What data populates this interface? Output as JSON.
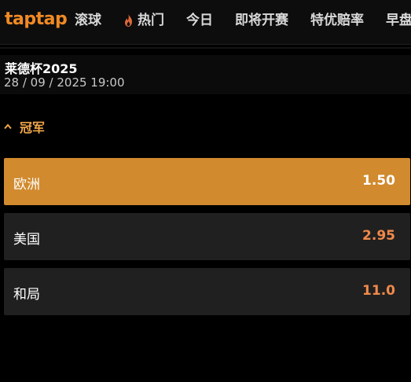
{
  "header": {
    "logo": "taptap",
    "nav": [
      "滚球",
      "热门",
      "今日",
      "即将开赛",
      "特优赔率",
      "早盘"
    ]
  },
  "event": {
    "title": "莱德杯2025",
    "datetime": "28 / 09 / 2025 19:00"
  },
  "market": {
    "title": "冠军",
    "outcomes": [
      {
        "label": "欧洲",
        "odds": "1.50",
        "selected": true
      },
      {
        "label": "美国",
        "odds": "2.95",
        "selected": false
      },
      {
        "label": "和局",
        "odds": "11.0",
        "selected": false
      }
    ]
  },
  "colors": {
    "brand": "#f08a24",
    "selected_row": "#d18a2e",
    "row": "#202020",
    "odds": "#f08a4a",
    "section_title": "#f0a64a"
  }
}
